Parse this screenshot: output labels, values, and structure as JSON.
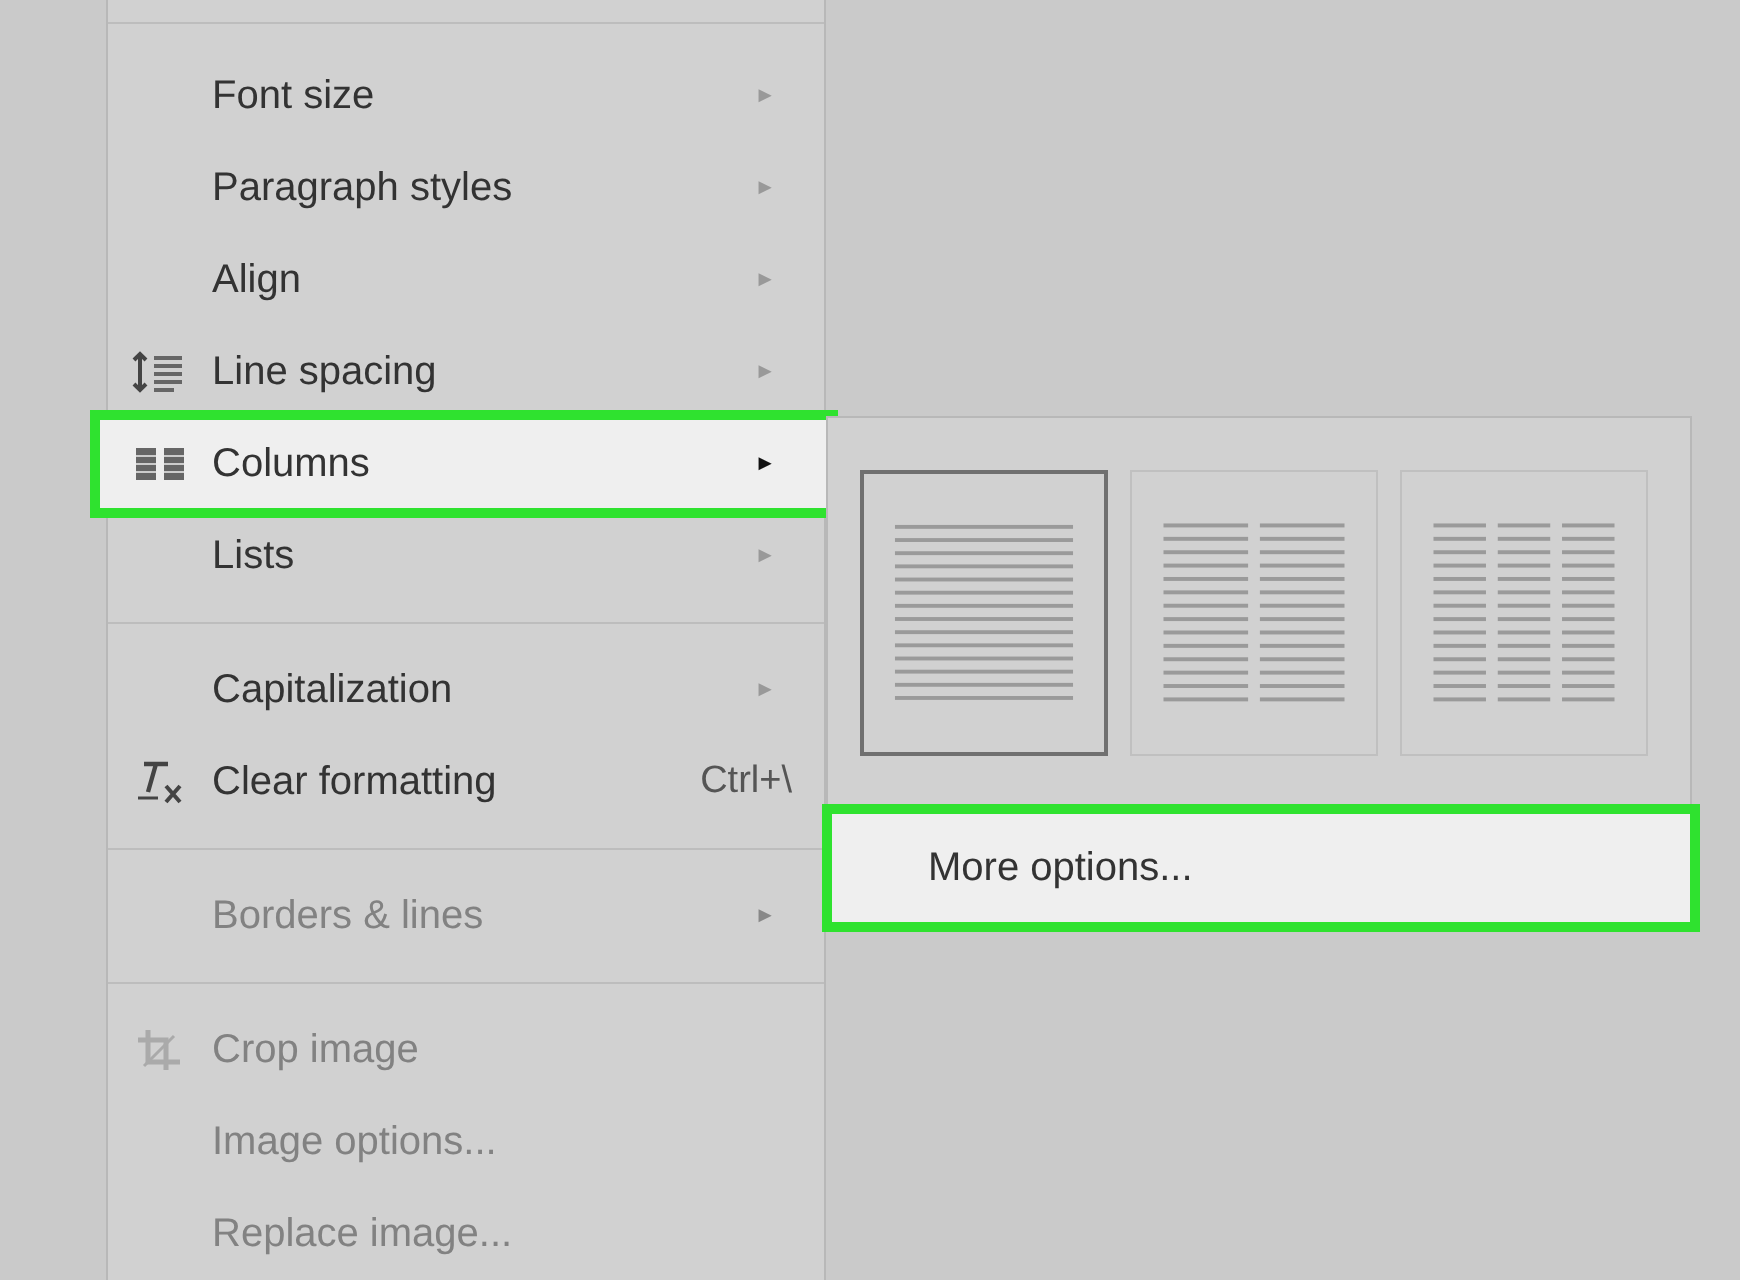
{
  "format_menu": {
    "items": [
      {
        "kind": "item",
        "label": "Font size",
        "arrow": "►",
        "disabled": false,
        "highlighted": false
      },
      {
        "kind": "item",
        "label": "Paragraph styles",
        "arrow": "►",
        "disabled": false,
        "highlighted": false
      },
      {
        "kind": "item",
        "label": "Align",
        "arrow": "►",
        "disabled": false,
        "highlighted": false
      },
      {
        "kind": "item",
        "label": "Line spacing",
        "arrow": "►",
        "disabled": false,
        "highlighted": false
      },
      {
        "kind": "item",
        "label": "Columns",
        "arrow": "►",
        "disabled": false,
        "highlighted": true
      },
      {
        "kind": "item",
        "label": "Lists",
        "arrow": "►",
        "disabled": false,
        "highlighted": false
      },
      {
        "kind": "separator"
      },
      {
        "kind": "item",
        "label": "Capitalization",
        "arrow": "►",
        "disabled": false,
        "highlighted": false
      },
      {
        "kind": "item",
        "label": "Clear formatting",
        "shortcut": "Ctrl+\\",
        "disabled": false,
        "highlighted": false
      },
      {
        "kind": "separator"
      },
      {
        "kind": "item",
        "label": "Borders & lines",
        "arrow": "►",
        "disabled": true,
        "highlighted": false
      },
      {
        "kind": "separator"
      },
      {
        "kind": "item",
        "label": "Crop image",
        "disabled": true,
        "highlighted": false
      },
      {
        "kind": "item",
        "label": "Image options...",
        "disabled": true,
        "highlighted": false
      },
      {
        "kind": "item",
        "label": "Replace image...",
        "disabled": true,
        "highlighted": false
      }
    ]
  },
  "columns_submenu": {
    "layouts": [
      {
        "selected": true
      },
      {
        "selected": false
      },
      {
        "selected": false
      }
    ],
    "more_options": {
      "label": "More options...",
      "highlighted": true
    }
  }
}
